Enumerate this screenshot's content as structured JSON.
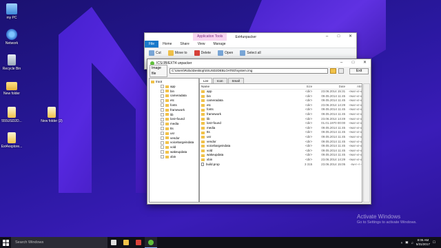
{
  "desktop": {
    "icons": [
      {
        "label": "my PC",
        "icon": "pc-icon"
      },
      {
        "label": "Network",
        "icon": "network-icon"
      },
      {
        "label": "Recycle Bin",
        "icon": "recycle-bin-icon"
      },
      {
        "label": "New folder",
        "icon": "folder-icon"
      },
      {
        "label": "555USD2D...",
        "icon": "file-icon"
      },
      {
        "label": "New folder (2)",
        "icon": "folder-icon"
      },
      {
        "label": "Ext4explore...",
        "icon": "file-icon"
      }
    ]
  },
  "explorer": {
    "tools_tab": "Application Tools",
    "title": "Ext4unpacker",
    "tabs": [
      "File",
      "Home",
      "Share",
      "View",
      "Manage"
    ],
    "ribbon": {
      "cut": "Cut",
      "copy_path": "Copy path",
      "move_to": "Move to",
      "delete": "Delete",
      "open": "Open",
      "select_all": "Select all",
      "select_none": "Select none"
    }
  },
  "unpacker": {
    "title": "ICS/JB/EXT4 unpacker",
    "image_file_label": "Image file",
    "image_path": "C:\\Users\\Robu\\Desktop\\SSUSD2DEBLOATED\\system.img",
    "exit_label": "Exit",
    "tabs": [
      "List",
      "Icon",
      "Small"
    ],
    "tree": {
      "root": "/root",
      "children": [
        "app",
        "bin",
        "cameradata",
        "etc",
        "fonts",
        "framework",
        "lib",
        "lost+found",
        "media",
        "tts",
        "usr",
        "vendor",
        "voicebargeindata",
        "vold",
        "wakeupdata",
        "xbin"
      ]
    },
    "columns": {
      "name": "Name",
      "size": "Size",
      "date": "Date",
      "attr": "Attr"
    },
    "rows": [
      {
        "name": "app",
        "size": "<dir>",
        "date": "23.06.2014 15:31",
        "attr": "-rwxr-xr-x",
        "type": "dir"
      },
      {
        "name": "bin",
        "size": "<dir>",
        "date": "09.05.2014 11:45",
        "attr": "-rwxr-xr-x",
        "type": "dir"
      },
      {
        "name": "cameradata",
        "size": "<dir>",
        "date": "09.05.2014 11:45",
        "attr": "-rwxr-xr-x",
        "type": "dir"
      },
      {
        "name": "etc",
        "size": "<dir>",
        "date": "23.06.2014 14:29",
        "attr": "-rwxr-xr-x",
        "type": "dir"
      },
      {
        "name": "fonts",
        "size": "<dir>",
        "date": "09.05.2014 11:45",
        "attr": "-rwxr-xr-x",
        "type": "dir"
      },
      {
        "name": "framework",
        "size": "<dir>",
        "date": "09.05.2014 11:45",
        "attr": "-rwxr-xr-x",
        "type": "dir"
      },
      {
        "name": "lib",
        "size": "<dir>",
        "date": "23.06.2014 14:49",
        "attr": "-rwxr-xr-x",
        "type": "dir"
      },
      {
        "name": "lost+found",
        "size": "<dir>",
        "date": "01.01.1970 00:00",
        "attr": "-rwxr-xr-x",
        "type": "dir"
      },
      {
        "name": "media",
        "size": "<dir>",
        "date": "09.05.2014 11:45",
        "attr": "-rwxr-xr-x",
        "type": "dir"
      },
      {
        "name": "tts",
        "size": "<dir>",
        "date": "09.05.2014 11:45",
        "attr": "-rwxr-xr-x",
        "type": "dir"
      },
      {
        "name": "usr",
        "size": "<dir>",
        "date": "09.05.2014 11:45",
        "attr": "-rwxr-xr-x",
        "type": "dir"
      },
      {
        "name": "vendor",
        "size": "<dir>",
        "date": "09.05.2014 11:45",
        "attr": "-rwxr-xr-x",
        "type": "dir"
      },
      {
        "name": "voicebargeindata",
        "size": "<dir>",
        "date": "09.05.2014 11:45",
        "attr": "-rwxr-xr-x",
        "type": "dir"
      },
      {
        "name": "vold",
        "size": "<dir>",
        "date": "09.05.2014 11:45",
        "attr": "-rwxr-xr-x",
        "type": "dir"
      },
      {
        "name": "wakeupdata",
        "size": "<dir>",
        "date": "09.05.2014 11:45",
        "attr": "-rwxr-xr-x",
        "type": "dir"
      },
      {
        "name": "xbin",
        "size": "<dir>",
        "date": "23.06.2014 14:29",
        "attr": "-rwxr-xr-x",
        "type": "dir"
      },
      {
        "name": "build.prop",
        "size": "3 315",
        "date": "23.06.2014 15:05",
        "attr": "-rw-r--r--",
        "type": "file"
      }
    ]
  },
  "watermark": {
    "line1": "Activate Windows",
    "line2": "Go to Settings to activate Windows."
  },
  "taskbar": {
    "search_placeholder": "Search Windows",
    "time": "8:05 AM",
    "date": "5/31/2017"
  },
  "colors": {
    "desktop_bg": "#2a18a0",
    "accent": "#1979ca",
    "folder": "#f1c24a"
  }
}
